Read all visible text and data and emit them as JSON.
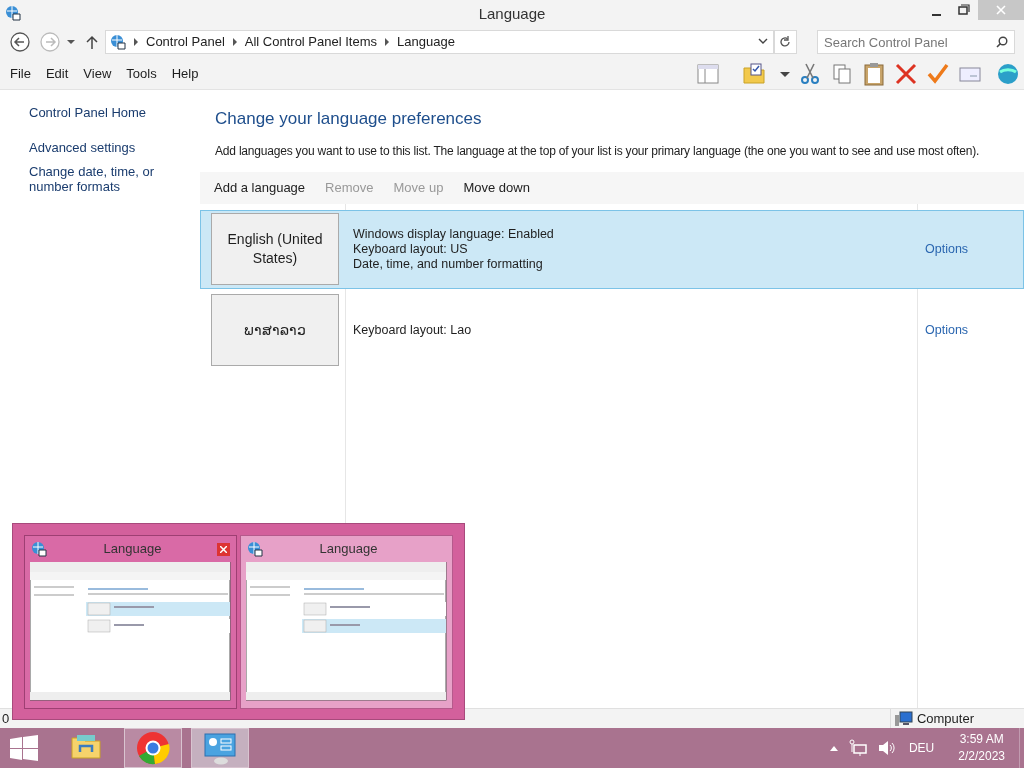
{
  "window": {
    "title": "Language"
  },
  "address": {
    "breadcrumb": [
      "Control Panel",
      "All Control Panel Items",
      "Language"
    ],
    "search_placeholder": "Search Control Panel"
  },
  "menu": [
    "File",
    "Edit",
    "View",
    "Tools",
    "Help"
  ],
  "sidebar": {
    "home": "Control Panel Home",
    "links": [
      "Advanced settings",
      "Change date, time, or number formats"
    ]
  },
  "heading": "Change your language preferences",
  "description": "Add languages you want to use to this list. The language at the top of your list is your primary language (the one you want to see and use most often).",
  "actions": [
    {
      "label": "Add a language",
      "disabled": false
    },
    {
      "label": "Remove",
      "disabled": true
    },
    {
      "label": "Move up",
      "disabled": true
    },
    {
      "label": "Move down",
      "disabled": false
    }
  ],
  "languages": [
    {
      "name": "English (United States)",
      "selected": true,
      "details": [
        "Windows display language: Enabled",
        "Keyboard layout: US",
        "Date, time, and number formatting"
      ],
      "options": "Options"
    },
    {
      "name": "ພາສາລາວ",
      "selected": false,
      "details": [
        "Keyboard layout: Lao"
      ],
      "options": "Options"
    }
  ],
  "status_bar": {
    "items": "0",
    "location": "Computer"
  },
  "previews": [
    {
      "title": "Language",
      "hovered": true
    },
    {
      "title": "Language",
      "hovered": false
    }
  ],
  "taskbar": {
    "apps": [
      {
        "kind": "explorer",
        "running": false,
        "selected": false
      },
      {
        "kind": "chrome",
        "running": true,
        "selected": false
      },
      {
        "kind": "control-panel",
        "running": true,
        "selected": true
      }
    ],
    "tray": {
      "input": "DEU",
      "time": "3:59 AM",
      "date": "2/2/2023"
    }
  }
}
